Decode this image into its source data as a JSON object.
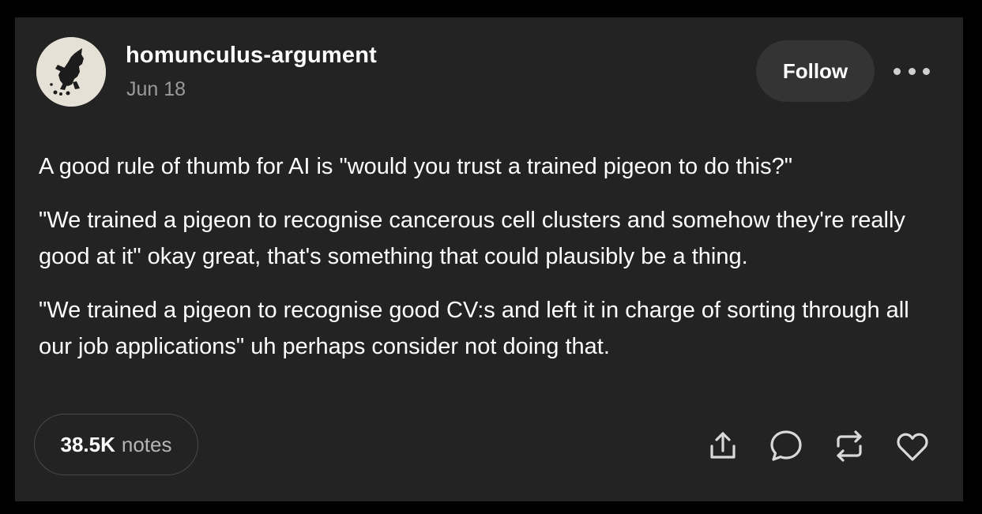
{
  "post": {
    "username": "homunculus-argument",
    "date": "Jun 18",
    "follow_label": "Follow",
    "paragraphs": [
      "A good rule of thumb for AI is \"would you trust a trained pigeon to do this?\"",
      "\"We trained a pigeon to recognise cancerous cell clusters and somehow they're really good at it\" okay great, that's something that could plausibly be a thing.",
      "\"We trained a pigeon to recognise good CV:s and left it in charge of sorting through all our job applications\" uh perhaps consider not doing that."
    ]
  },
  "footer": {
    "notes_count": "38.5K",
    "notes_label": "notes",
    "actions": [
      "share-icon",
      "reply-icon",
      "reblog-icon",
      "like-icon"
    ]
  },
  "colors": {
    "background": "#000000",
    "card": "#232323",
    "follow_button": "#343434",
    "muted_text": "#9a9a9a"
  },
  "icons": {
    "more": "more-icon",
    "avatar": "avatar-image"
  }
}
